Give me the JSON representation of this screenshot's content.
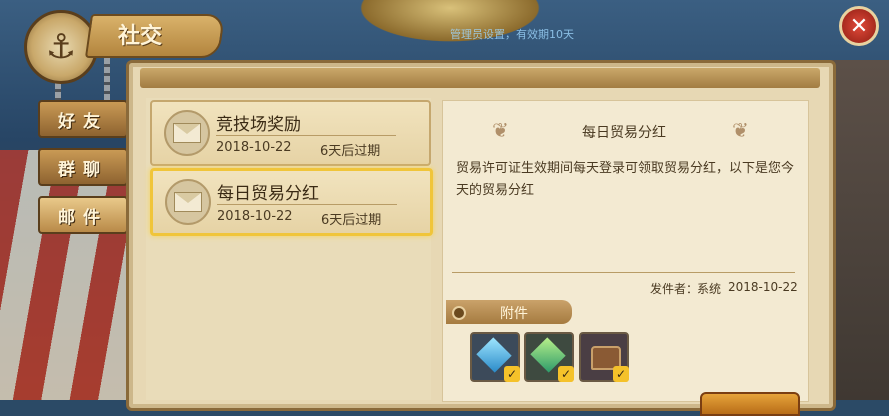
{
  "top_notice": "管理员设置，有效期10天",
  "header": {
    "title": "社交",
    "emblem": "anchor-icon",
    "close_icon": "close-icon"
  },
  "side_tabs": [
    {
      "label": "好友"
    },
    {
      "label": "群聊"
    },
    {
      "label": "邮件"
    }
  ],
  "mails": [
    {
      "title": "竞技场奖励",
      "date": "2018-10-22",
      "expires": "6天后过期"
    },
    {
      "title": "每日贸易分红",
      "date": "2018-10-22",
      "expires": "6天后过期"
    }
  ],
  "detail": {
    "title": "每日贸易分红",
    "body": "贸易许可证生效期间每天登录可领取贸易分红，以下是您今天的贸易分红",
    "sender_label": "发件者：",
    "sender_name": "系统",
    "sender_date": "2018-10-22",
    "attachments_label": "附件",
    "attachments": [
      {
        "icon": "blue-diamond-icon",
        "claimed": true
      },
      {
        "icon": "green-diamond-icon",
        "claimed": true
      },
      {
        "icon": "treasure-chest-icon",
        "claimed": true
      }
    ]
  }
}
